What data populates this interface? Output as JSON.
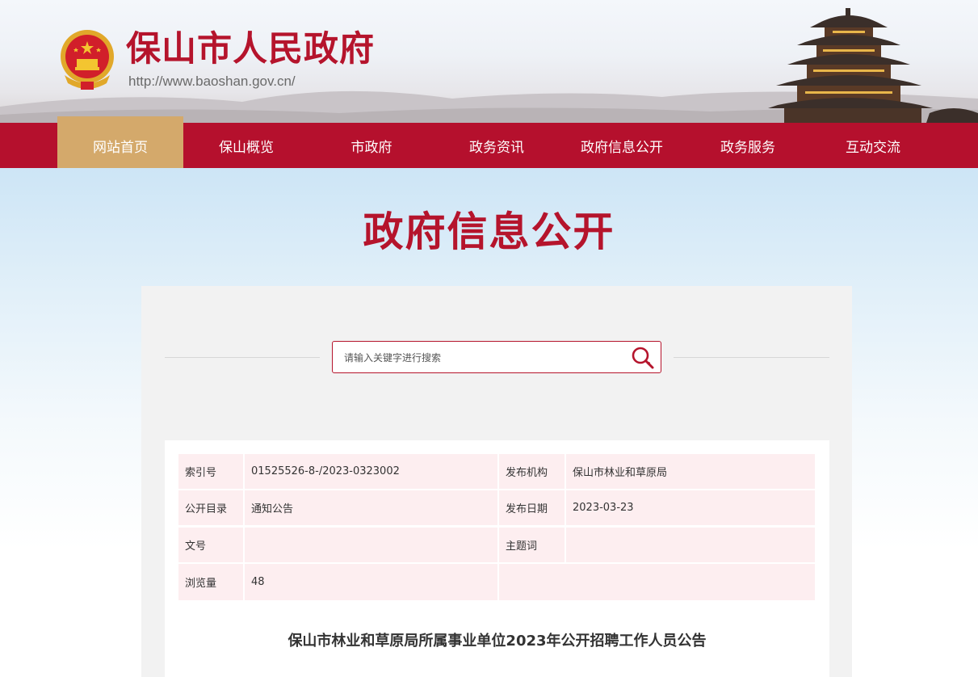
{
  "header": {
    "site_title": "保山市人民政府",
    "site_url": "http://www.baoshan.gov.cn/",
    "logo_icon": "national-emblem-icon"
  },
  "nav": {
    "items": [
      {
        "label": "网站首页",
        "active": true
      },
      {
        "label": "保山概览",
        "active": false
      },
      {
        "label": "市政府",
        "active": false
      },
      {
        "label": "政务资讯",
        "active": false
      },
      {
        "label": "政府信息公开",
        "active": false
      },
      {
        "label": "政务服务",
        "active": false
      },
      {
        "label": "互动交流",
        "active": false
      }
    ]
  },
  "page": {
    "title": "政府信息公开"
  },
  "search": {
    "placeholder": "请输入关键字进行搜索",
    "icon": "search-icon"
  },
  "info": {
    "index_label": "索引号",
    "index_value": "01525526-8-/2023-0323002",
    "publisher_label": "发布机构",
    "publisher_value": "保山市林业和草原局",
    "catalog_label": "公开目录",
    "catalog_value": "通知公告",
    "date_label": "发布日期",
    "date_value": "2023-03-23",
    "docno_label": "文号",
    "docno_value": "",
    "keyword_label": "主题词",
    "keyword_value": "",
    "views_label": "浏览量",
    "views_value": "48"
  },
  "article": {
    "title": "保山市林业和草原局所属事业单位2023年公开招聘工作人员公告"
  },
  "colors": {
    "brand_red": "#b5102d",
    "nav_active": "#d4a96b",
    "table_bg": "#fdeef0"
  }
}
